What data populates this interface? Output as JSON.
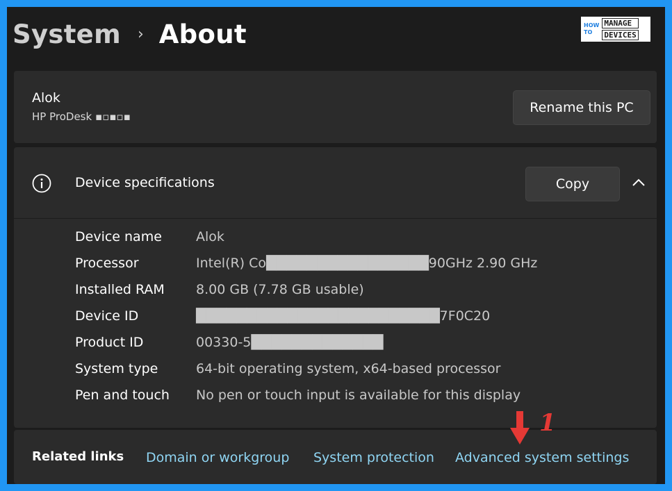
{
  "breadcrumb": {
    "parent": "System",
    "separator": "›",
    "current": "About"
  },
  "logo": {
    "small_top": "HOW",
    "small_bottom": "TO",
    "line1": "MANAGE",
    "line2": "DEVICES"
  },
  "pc": {
    "name": "Alok",
    "model": "HP ProDesk ▪▫▪▫▪",
    "rename_label": "Rename this PC"
  },
  "specs": {
    "title": "Device specifications",
    "copy_label": "Copy",
    "rows": [
      {
        "label": "Device name",
        "value": "Alok"
      },
      {
        "label": "Processor",
        "value": "Intel(R) Co████████████████90GHz   2.90 GHz"
      },
      {
        "label": "Installed RAM",
        "value": "8.00 GB (7.78 GB usable)"
      },
      {
        "label": "Device ID",
        "value": "████████████████████████7F0C20"
      },
      {
        "label": "Product ID",
        "value": "00330-5█████████████"
      },
      {
        "label": "System type",
        "value": "64-bit operating system, x64-based processor"
      },
      {
        "label": "Pen and touch",
        "value": "No pen or touch input is available for this display"
      }
    ]
  },
  "related": {
    "label": "Related links",
    "links": [
      "Domain or workgroup",
      "System protection",
      "Advanced system settings"
    ]
  },
  "annotation": {
    "number": "1",
    "color": "#e53935"
  },
  "colors": {
    "frame_border": "#2196f3",
    "link": "#8fd5f3",
    "card": "#2b2b2b",
    "background": "#1c1c1c"
  }
}
